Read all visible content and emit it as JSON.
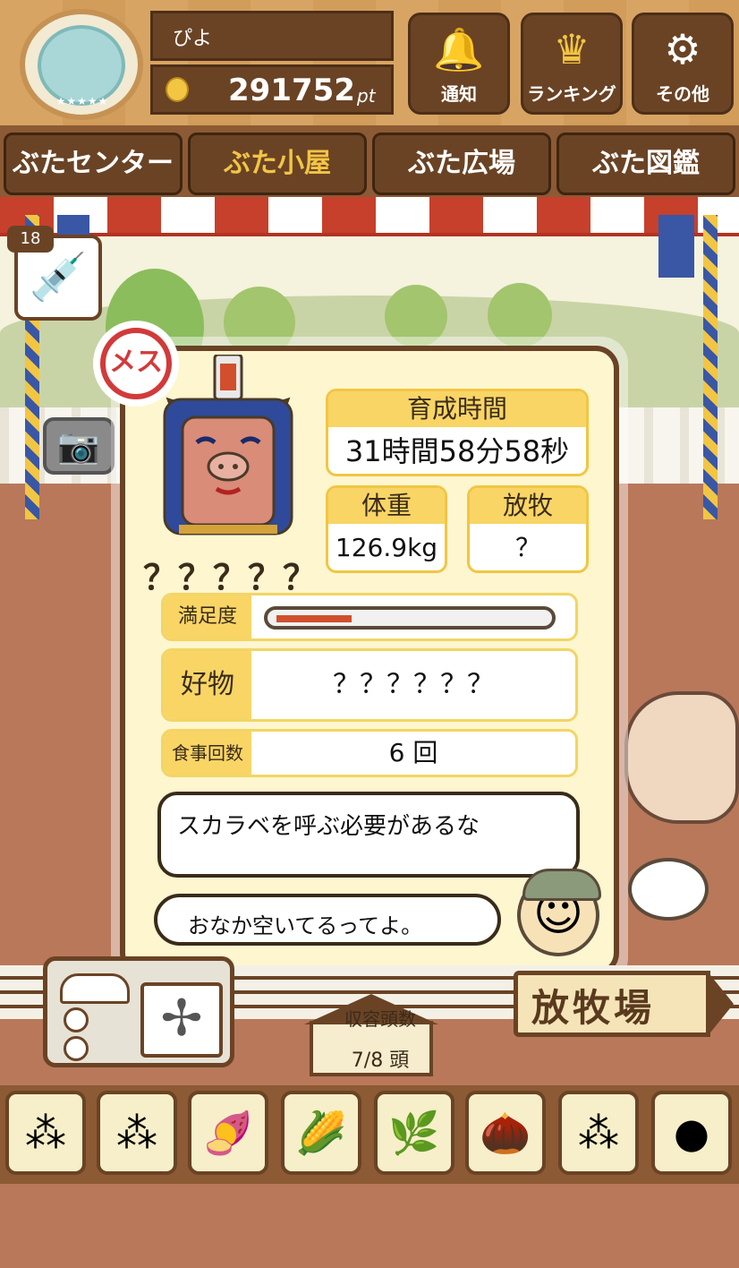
{
  "header": {
    "player_name": "ぴよ",
    "points": "291752",
    "points_unit": "pt",
    "buttons": [
      {
        "label": "通知",
        "icon": "bell-icon"
      },
      {
        "label": "ランキング",
        "icon": "crown-icon"
      },
      {
        "label": "その他",
        "icon": "gear-icon"
      }
    ]
  },
  "tabs": [
    {
      "label": "ぶたセンター"
    },
    {
      "label": "ぶた小屋"
    },
    {
      "label": "ぶた広場"
    },
    {
      "label": "ぶた図鑑"
    }
  ],
  "active_tab": "ぶた小屋",
  "syringe": {
    "count": "18",
    "icon": "syringe-icon"
  },
  "pig": {
    "gender_label": "メス",
    "name": "？？？？？",
    "stats": {
      "raise_time_label": "育成時間",
      "raise_time_value": "31時間58分58秒",
      "weight_label": "体重",
      "weight_value": "126.9kg",
      "grazing_label": "放牧",
      "grazing_value": "？",
      "satisfaction_label": "満足度",
      "satisfaction_level": 0.28,
      "favorite_label": "好物",
      "favorite_value": "？？？？？？",
      "meals_label": "食事回数",
      "meals_value": "6 回"
    },
    "speech": "スカラベを呼ぶ必要があるな",
    "farmer_speech": "おなか空いてるってよ。"
  },
  "capacity": {
    "label": "収容頭数",
    "value": "7/8 頭"
  },
  "pasture_sign": "放牧場",
  "food_items": [
    {
      "icon": "grain-pile-icon"
    },
    {
      "icon": "mixed-beans-icon"
    },
    {
      "icon": "sweet-potato-icon"
    },
    {
      "icon": "corn-icon"
    },
    {
      "icon": "herbs-icon"
    },
    {
      "icon": "acorn-icon"
    },
    {
      "icon": "grain-bowl-icon"
    },
    {
      "icon": "truffle-plate-icon"
    }
  ],
  "colors": {
    "wood": "#6a4325",
    "panel": "#fdf6cf",
    "accent_yellow": "#f8d565",
    "bar_red": "#d14f2c",
    "gender_red": "#d23a3a"
  }
}
